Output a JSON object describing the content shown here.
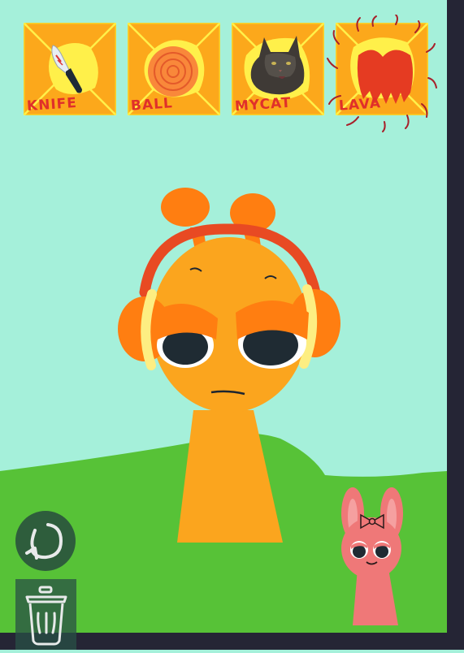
{
  "inventory": {
    "items": [
      {
        "label": "KNIFE",
        "icon": "knife-icon"
      },
      {
        "label": "BALL",
        "icon": "ball-icon"
      },
      {
        "label": "MYCAT",
        "icon": "cat-photo"
      },
      {
        "label": "LAVA",
        "icon": "lava-icon"
      }
    ]
  },
  "controls": {
    "reset_icon": "rotate-arrow-icon",
    "trash_icon": "trash-can-icon"
  },
  "colors": {
    "sky": "#a5f0da",
    "grass": "#57c237",
    "frame": "#252535",
    "tile_orange": "#fca81b",
    "tile_yellow": "#fff04a",
    "label_red": "#e0302a",
    "main_character": "#fba51e",
    "headphones": "#e84a23",
    "side_character": "#ef7878"
  }
}
